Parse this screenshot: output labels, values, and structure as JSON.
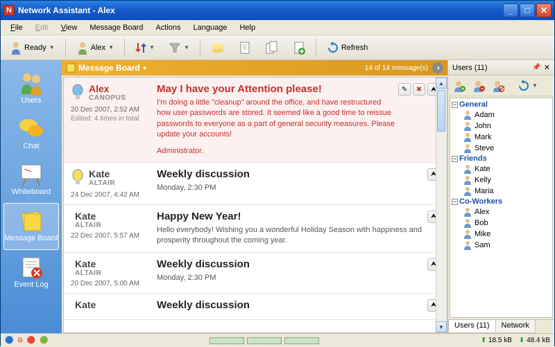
{
  "window": {
    "title": "Network Assistant - Alex"
  },
  "menu": {
    "file": "File",
    "edit": "Edit",
    "view": "View",
    "message_board": "Message Board",
    "actions": "Actions",
    "language": "Language",
    "help": "Help"
  },
  "toolbar": {
    "status_label": "Ready",
    "user_label": "Alex",
    "refresh": "Refresh"
  },
  "leftnav": {
    "users": "Users",
    "chat": "Chat",
    "whiteboard": "Whiteboard",
    "message_board": "Message Board",
    "event_log": "Event Log"
  },
  "board": {
    "title": "Message Board",
    "count": "14 of 14 message(s)",
    "messages": [
      {
        "author": "Alex",
        "host": "CANOPUS",
        "date": "20 Dec 2007,  2:52 AM",
        "edited": "Edited: 4 times in total",
        "title": "May I have your Attention please!",
        "body": "I'm doing a little \"cleanup\" around the office, and have restructured how user passwords are stored. It seemed like a good time to reissue passwords to everyone as a part of general security measures. Please update your accounts!",
        "sig": "Administrator.",
        "highlight": true,
        "bulb": "blue"
      },
      {
        "author": "Kate",
        "host": "ALTAIR",
        "date": "24 Dec 2007,  4:42 AM",
        "title": "Weekly discussion",
        "body": "Monday, 2:30 PM",
        "bulb": "yellow"
      },
      {
        "author": "Kate",
        "host": "ALTAIR",
        "date": "22 Dec 2007,  5:57 AM",
        "title": "Happy New Year!",
        "body": "Hello everybody! Wishing you a wonderful Holiday Season with happiness and prosperity throughout the coming year."
      },
      {
        "author": "Kate",
        "host": "ALTAIR",
        "date": "20 Dec 2007,  5:00 AM",
        "title": "Weekly discussion",
        "body": "Monday, 2:30 PM"
      },
      {
        "author": "Kate",
        "host": "",
        "date": "",
        "title": "Weekly discussion",
        "body": ""
      }
    ]
  },
  "users_panel": {
    "title": "Users (11)",
    "tab_users": "Users (11)",
    "tab_network": "Network",
    "groups": [
      {
        "name": "General",
        "items": [
          "Adam",
          "John",
          "Mark",
          "Steve"
        ]
      },
      {
        "name": "Friends",
        "items": [
          "Kate",
          "Kelly",
          "Maria"
        ]
      },
      {
        "name": "Co-Workers",
        "items": [
          "Alex",
          "Bob",
          "Mike",
          "Sam"
        ]
      }
    ]
  },
  "status": {
    "up": "18.5 kB",
    "down": "48.4 kB"
  }
}
